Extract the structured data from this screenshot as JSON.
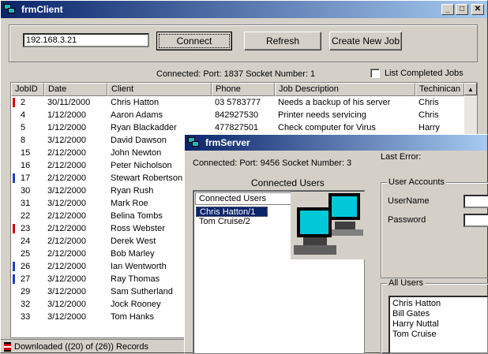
{
  "client": {
    "title": "frmClient",
    "ip_value": "192.168.3.21",
    "buttons": {
      "connect": "Connect",
      "refresh": "Refresh",
      "create": "Create New Job"
    },
    "status": "Connected:  Port: 1837 Socket Number: 1",
    "list_completed": "List Completed Jobs",
    "columns": [
      "JobID",
      "Date",
      "Client",
      "Phone",
      "Job Description",
      "Techinican"
    ],
    "rows": [
      {
        "id": "2",
        "date": "30/11/2000",
        "client": "Chris Hatton",
        "phone": "03 5783777",
        "desc": "Needs a backup of his server",
        "tech": "Chris",
        "flag": "red"
      },
      {
        "id": "4",
        "date": "1/12/2000",
        "client": "Aaron Adams",
        "phone": "842927530",
        "desc": "Printer needs servicing",
        "tech": "Chris",
        "flag": ""
      },
      {
        "id": "5",
        "date": "1/12/2000",
        "client": "Ryan Blackadder",
        "phone": "477827501",
        "desc": "Check computer for Virus",
        "tech": "Harry",
        "flag": ""
      },
      {
        "id": "8",
        "date": "3/12/2000",
        "client": "David Dawson",
        "phone": "",
        "desc": "",
        "tech": "",
        "flag": ""
      },
      {
        "id": "15",
        "date": "2/12/2000",
        "client": "John Newton",
        "phone": "",
        "desc": "",
        "tech": "",
        "flag": ""
      },
      {
        "id": "16",
        "date": "2/12/2000",
        "client": "Peter Nicholson",
        "phone": "",
        "desc": "",
        "tech": "",
        "flag": ""
      },
      {
        "id": "17",
        "date": "2/12/2000",
        "client": "Stewart Robertson",
        "phone": "",
        "desc": "",
        "tech": "",
        "flag": "blue"
      },
      {
        "id": "30",
        "date": "3/12/2000",
        "client": "Ryan Rush",
        "phone": "",
        "desc": "",
        "tech": "",
        "flag": ""
      },
      {
        "id": "31",
        "date": "3/12/2000",
        "client": "Mark Roe",
        "phone": "",
        "desc": "",
        "tech": "",
        "flag": ""
      },
      {
        "id": "22",
        "date": "2/12/2000",
        "client": "Belina Tombs",
        "phone": "",
        "desc": "",
        "tech": "",
        "flag": ""
      },
      {
        "id": "23",
        "date": "2/12/2000",
        "client": "Ross Webster",
        "phone": "",
        "desc": "",
        "tech": "",
        "flag": "red"
      },
      {
        "id": "24",
        "date": "2/12/2000",
        "client": "Derek West",
        "phone": "",
        "desc": "",
        "tech": "",
        "flag": ""
      },
      {
        "id": "25",
        "date": "2/12/2000",
        "client": "Bob Marley",
        "phone": "",
        "desc": "",
        "tech": "",
        "flag": ""
      },
      {
        "id": "26",
        "date": "2/12/2000",
        "client": "Ian Wentworth",
        "phone": "",
        "desc": "",
        "tech": "",
        "flag": "blue"
      },
      {
        "id": "27",
        "date": "3/12/2000",
        "client": "Ray Thomas",
        "phone": "",
        "desc": "",
        "tech": "",
        "flag": "blue"
      },
      {
        "id": "29",
        "date": "3/12/2000",
        "client": "Sam Sutherland",
        "phone": "",
        "desc": "",
        "tech": "",
        "flag": ""
      },
      {
        "id": "32",
        "date": "3/12/2000",
        "client": "Jock Rooney",
        "phone": "",
        "desc": "",
        "tech": "",
        "flag": ""
      },
      {
        "id": "33",
        "date": "3/12/2000",
        "client": "Tom Hanks",
        "phone": "",
        "desc": "",
        "tech": "",
        "flag": ""
      }
    ],
    "statusbar": "Downloaded ((20) of (26)) Records"
  },
  "server": {
    "title": "frmServer",
    "status": "Connected:  Port: 9456 Socket Number: 3",
    "last_error": "Last Error:",
    "connected_users_label": "Connected Users",
    "connected_users_header": "Connected Users",
    "connected_users": [
      "Chris Hatton/1",
      "Tom Cruise/2"
    ],
    "user_accounts": {
      "legend": "User Accounts",
      "username": "UserName",
      "password": "Password"
    },
    "all_users_legend": "All Users",
    "all_users": [
      "Chris Hatton",
      "Bill Gates",
      "Harry Nuttal",
      "Tom Cruise"
    ]
  }
}
